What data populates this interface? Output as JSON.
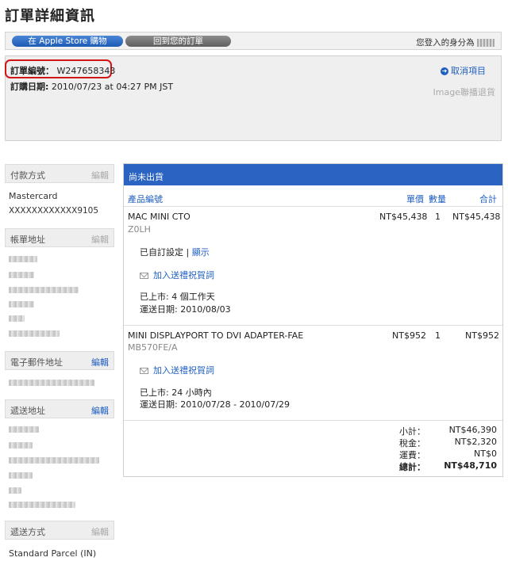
{
  "page_title": "訂單詳細資訊",
  "nav": {
    "store_button": "在 Apple Store 購物",
    "back_button": "回到您的訂單",
    "signed_in_as": "您登入的身分為"
  },
  "order": {
    "number_label": "訂單編號：",
    "number_value": "W247658343",
    "date_label": "訂購日期:",
    "date_value": "2010/07/23 at 04:27 PM JST",
    "cancel_link": "取消項目",
    "image_link": "Image聯播退貨"
  },
  "sidebar": {
    "payment": {
      "title": "付款方式",
      "edit": "編輯",
      "method": "Mastercard",
      "card": "XXXXXXXXXXXX9105"
    },
    "billing": {
      "title": "帳單地址",
      "edit": "編輯"
    },
    "email": {
      "title": "電子郵件地址",
      "edit": "編輯"
    },
    "shipping_address": {
      "title": "遞送地址",
      "edit": "編輯"
    },
    "shipping_method": {
      "title": "遞送方式",
      "edit": "編輯",
      "value": "Standard Parcel (IN)"
    }
  },
  "items_panel": {
    "status": "尚未出貨",
    "columns": {
      "product": "產品編號",
      "price": "單價",
      "qty": "數量",
      "total": "合計"
    },
    "items": [
      {
        "name": "MAC MINI CTO",
        "code": "Z0LH",
        "price": "NT$45,438",
        "qty": "1",
        "total": "NT$45,438",
        "config_text": "已自訂設定",
        "config_sep": "|",
        "config_link": "顯示",
        "gift_link": "加入送禮祝賀詞",
        "ships_line": "已上市: 4 個工作天",
        "delivery_line": "運送日期: 2010/08/03"
      },
      {
        "name": "MINI DISPLAYPORT TO DVI ADAPTER-FAE",
        "code": "MB570FE/A",
        "price": "NT$952",
        "qty": "1",
        "total": "NT$952",
        "gift_link": "加入送禮祝賀詞",
        "ships_line": "已上市: 24 小時內",
        "delivery_line": "運送日期: 2010/07/28 - 2010/07/29"
      }
    ],
    "totals": {
      "subtotal_label": "小計：",
      "subtotal": "NT$46,390",
      "tax_label": "稅金：",
      "tax": "NT$2,320",
      "shipping_label": "運費：",
      "shipping": "NT$0",
      "grand_label": "總計：",
      "grand": "NT$48,710"
    }
  }
}
